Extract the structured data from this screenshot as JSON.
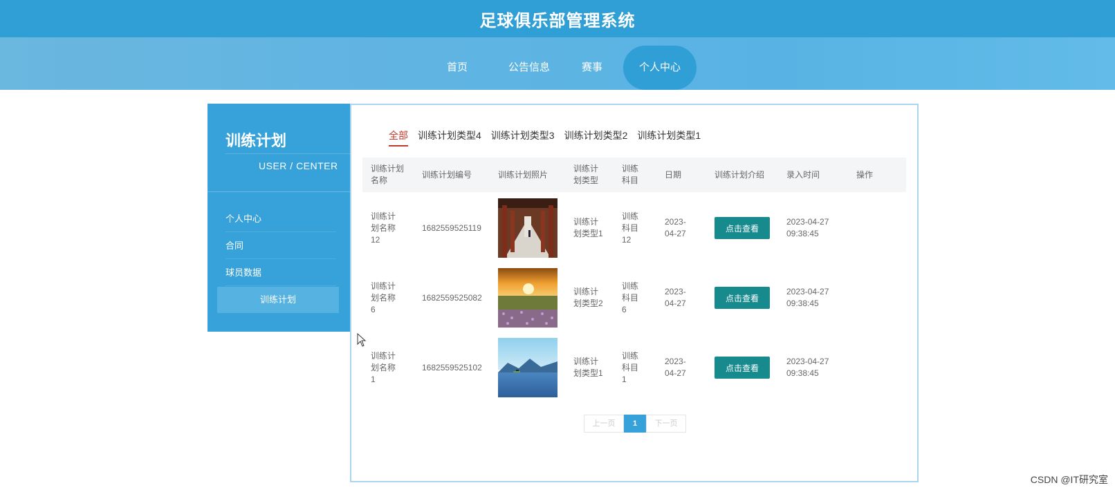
{
  "header": {
    "title": "足球俱乐部管理系统"
  },
  "nav": {
    "items": [
      "首页",
      "公告信息",
      "赛事",
      "个人中心"
    ],
    "active_index": 3
  },
  "sidebar": {
    "title": "训练计划",
    "subtitle": "USER / CENTER",
    "items": [
      "个人中心",
      "合同",
      "球员数据",
      "训练计划"
    ],
    "active_index": 3
  },
  "filter_tabs": {
    "items": [
      "全部",
      "训练计划类型4",
      "训练计划类型3",
      "训练计划类型2",
      "训练计划类型1"
    ],
    "active_index": 0
  },
  "table": {
    "headers": [
      "训练计划名称",
      "训练计划编号",
      "训练计划照片",
      "训练计划类型",
      "训练科目",
      "日期",
      "训练计划介绍",
      "录入时间",
      "操作"
    ],
    "rows": [
      {
        "name": "训练计划名称12",
        "code": "1682559525119",
        "photo": "colonnade-photo",
        "type": "训练计划类型1",
        "subject": "训练科目12",
        "date": "2023-04-27",
        "intro_button": "点击查看",
        "time": "2023-04-27 09:38:45"
      },
      {
        "name": "训练计划名称6",
        "code": "1682559525082",
        "photo": "sunset-meadow-photo",
        "type": "训练计划类型2",
        "subject": "训练科目6",
        "date": "2023-04-27",
        "intro_button": "点击查看",
        "time": "2023-04-27 09:38:45"
      },
      {
        "name": "训练计划名称1",
        "code": "1682559525102",
        "photo": "lake-photo",
        "type": "训练计划类型1",
        "subject": "训练科目1",
        "date": "2023-04-27",
        "intro_button": "点击查看",
        "time": "2023-04-27 09:38:45"
      }
    ]
  },
  "pagination": {
    "prev": "上一页",
    "current": "1",
    "next": "下一页"
  },
  "watermark": "CSDN @IT研究室",
  "colors": {
    "primary": "#2f9fd6",
    "button": "#178a8e",
    "active_tab": "#c0392b"
  }
}
